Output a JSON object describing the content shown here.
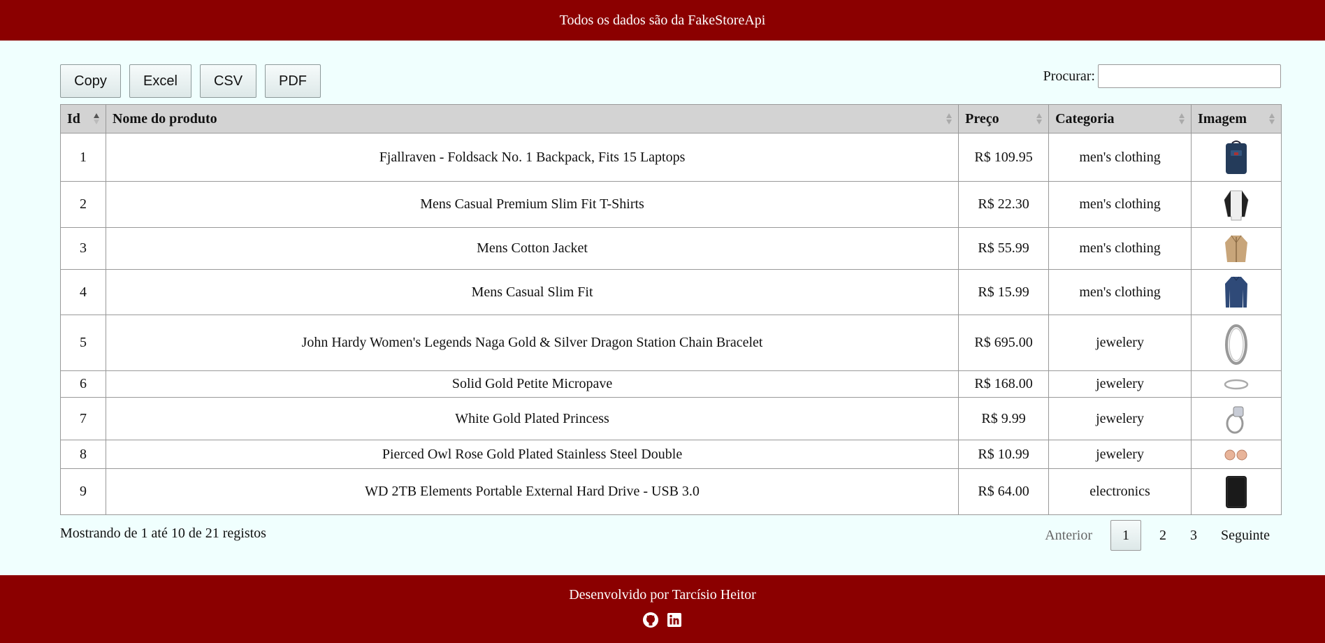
{
  "header": {
    "text": "Todos os dados são da FakeStoreApi"
  },
  "toolbar": {
    "buttons": [
      "Copy",
      "Excel",
      "CSV",
      "PDF"
    ],
    "search_label": "Procurar:",
    "search_value": ""
  },
  "table": {
    "columns": [
      "Id",
      "Nome do produto",
      "Preço",
      "Categoria",
      "Imagem"
    ],
    "sorted_column": "Id",
    "rows": [
      {
        "id": "1",
        "name": "Fjallraven - Foldsack No. 1 Backpack, Fits 15 Laptops",
        "price": "R$ 109.95",
        "category": "men's clothing",
        "image": "backpack"
      },
      {
        "id": "2",
        "name": "Mens Casual Premium Slim Fit T-Shirts",
        "price": "R$ 22.30",
        "category": "men's clothing",
        "image": "t-shirt"
      },
      {
        "id": "3",
        "name": "Mens Cotton Jacket",
        "price": "R$ 55.99",
        "category": "men's clothing",
        "image": "jacket"
      },
      {
        "id": "4",
        "name": "Mens Casual Slim Fit",
        "price": "R$ 15.99",
        "category": "men's clothing",
        "image": "long-sleeve-shirt"
      },
      {
        "id": "5",
        "name": "John Hardy Women's Legends Naga Gold & Silver Dragon Station Chain Bracelet",
        "price": "R$ 695.00",
        "category": "jewelery",
        "image": "bracelet"
      },
      {
        "id": "6",
        "name": "Solid Gold Petite Micropave",
        "price": "R$ 168.00",
        "category": "jewelery",
        "image": "ring-band"
      },
      {
        "id": "7",
        "name": "White Gold Plated Princess",
        "price": "R$ 9.99",
        "category": "jewelery",
        "image": "ring"
      },
      {
        "id": "8",
        "name": "Pierced Owl Rose Gold Plated Stainless Steel Double",
        "price": "R$ 10.99",
        "category": "jewelery",
        "image": "earrings"
      },
      {
        "id": "9",
        "name": "WD 2TB Elements Portable External Hard Drive - USB 3.0",
        "price": "R$ 64.00",
        "category": "electronics",
        "image": "hard-drive"
      }
    ]
  },
  "info": "Mostrando de 1 até 10 de 21 registos",
  "pagination": {
    "previous": "Anterior",
    "pages": [
      "1",
      "2",
      "3"
    ],
    "current": "1",
    "next": "Seguinte"
  },
  "footer": {
    "text": "Desenvolvido por Tarcísio Heitor",
    "icons": [
      "github-icon",
      "linkedin-icon"
    ]
  },
  "colors": {
    "brand": "#8b0000",
    "background": "#f0fffe",
    "header_cell": "#d3d3d3"
  }
}
